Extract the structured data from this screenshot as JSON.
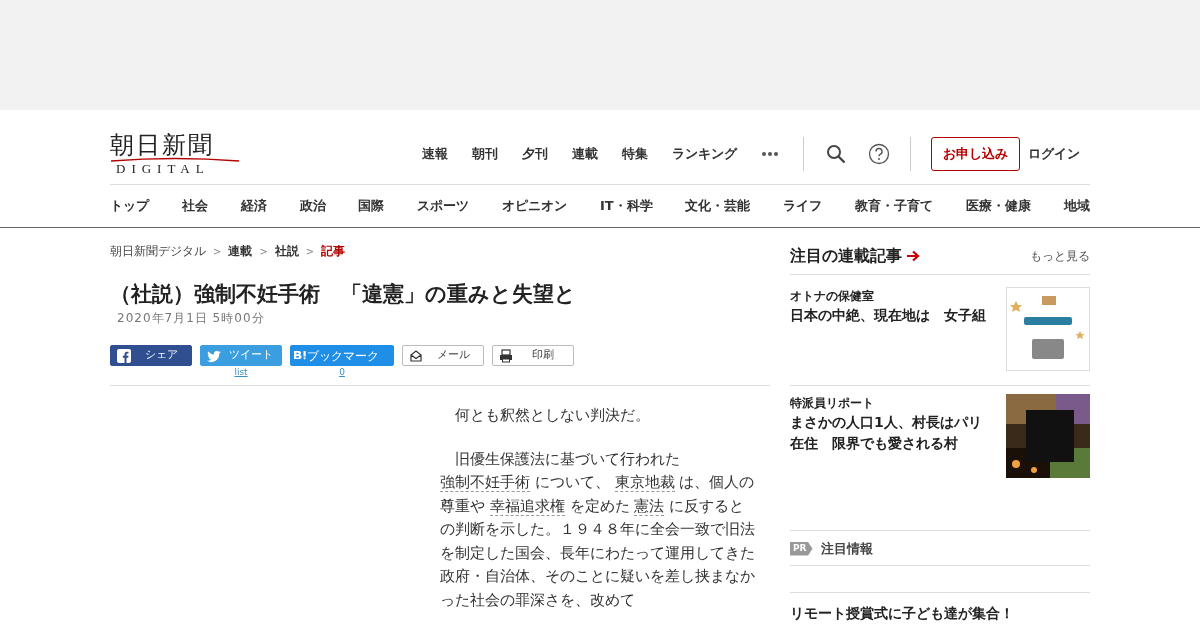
{
  "logo": {
    "title": "朝日新聞",
    "subtitle": "DIGITAL"
  },
  "top_nav": [
    "速報",
    "朝刊",
    "夕刊",
    "連載",
    "特集",
    "ランキング"
  ],
  "header_buttons": {
    "subscribe": "お申し込み",
    "login": "ログイン"
  },
  "category_nav": [
    "トップ",
    "社会",
    "経済",
    "政治",
    "国際",
    "スポーツ",
    "オピニオン",
    "IT・科学",
    "文化・芸能",
    "ライフ",
    "教育・子育て",
    "医療・健康",
    "地域"
  ],
  "breadcrumb": [
    {
      "label": "朝日新聞デジタル",
      "selected": false
    },
    {
      "separator": ">",
      "label": "連載",
      "selected": false
    },
    {
      "separator": ">",
      "label": "社説",
      "selected": false
    },
    {
      "separator": ">",
      "label": "記事",
      "selected": true
    }
  ],
  "article": {
    "title": "（社説）強制不妊手術　「違憲」の重みと失望と",
    "date": "2020年7月1日 5時00分",
    "share": [
      {
        "kind": "facebook",
        "label": "シェア"
      },
      {
        "kind": "twitter",
        "label": "ツイート",
        "count": "list"
      },
      {
        "kind": "hatena",
        "label": "ブックマーク",
        "count": "0"
      },
      {
        "kind": "mail",
        "label": "メール"
      },
      {
        "kind": "print",
        "label": "印刷"
      }
    ],
    "paragraphs": [
      [
        {
          "text": "何とも釈然としない判決だ。",
          "link": false
        }
      ],
      [
        {
          "text": "旧優生保護法に基づいて行われた",
          "link": false
        },
        {
          "text": "強制不妊手術",
          "link": true
        },
        {
          "text": "について、",
          "link": false
        },
        {
          "text": "東京地裁",
          "link": true
        },
        {
          "text": "は、個人の尊重や",
          "link": false
        },
        {
          "text": "幸福追求権",
          "link": true
        },
        {
          "text": "を定めた",
          "link": false
        },
        {
          "text": "憲法",
          "link": true
        },
        {
          "text": "に反するとの判断を示した。１９４８年に全会一致で旧法を制定した国会、長年にわたって運用してきた政府・自治体、そのことに疑いを差し挟まなかった社会の罪深さを、改めて",
          "link": false
        }
      ]
    ]
  },
  "sidebar": {
    "heading": "注目の連載記事",
    "more": "もっと見る",
    "items": [
      {
        "series": "オトナの保健室",
        "title": "日本の中絶、現在地は　女子組"
      },
      {
        "series": "特派員リポート",
        "title": "まさかの人口1人、村長はパリ在住　限界でも愛される村"
      }
    ],
    "pr": {
      "badge": "PR",
      "heading": "注目情報",
      "title": "リモート授賞式に子ども達が集合！"
    }
  }
}
